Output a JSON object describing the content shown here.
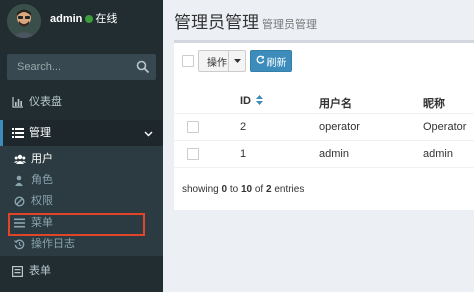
{
  "user": {
    "name": "admin",
    "status": "在线",
    "status_color": "#3c9c3c"
  },
  "search": {
    "placeholder": "Search...",
    "icon": "search-icon"
  },
  "sidebar": {
    "items": [
      {
        "label": "仪表盘",
        "icon": "bar-chart-icon"
      },
      {
        "label": "管理",
        "icon": "list-icon",
        "expanded": true
      },
      {
        "label": "表单",
        "icon": "form-icon"
      }
    ],
    "submenu": [
      {
        "label": "用户",
        "icon": "users-icon",
        "current": true
      },
      {
        "label": "角色",
        "icon": "user-icon"
      },
      {
        "label": "权限",
        "icon": "ban-icon"
      },
      {
        "label": "菜单",
        "icon": "bars-icon",
        "highlighted": true
      },
      {
        "label": "操作日志",
        "icon": "history-icon"
      }
    ]
  },
  "page": {
    "title": "管理员管理",
    "subtitle": "管理员管理"
  },
  "toolbar": {
    "action_label": "操作",
    "refresh_label": "刷新"
  },
  "table": {
    "columns": [
      "ID",
      "用户名",
      "昵称"
    ],
    "rows": [
      {
        "id": "2",
        "username": "operator",
        "nickname": "Operator"
      },
      {
        "id": "1",
        "username": "admin",
        "nickname": "admin"
      }
    ],
    "footer": {
      "prefix": "showing",
      "from": "0",
      "to_word": "to",
      "to": "10",
      "of_word": "of",
      "total": "2",
      "suffix": "entries"
    }
  },
  "colors": {
    "sidebar_bg": "#222d32",
    "accent": "#3c8dbc",
    "highlight_border": "#e0452a"
  }
}
